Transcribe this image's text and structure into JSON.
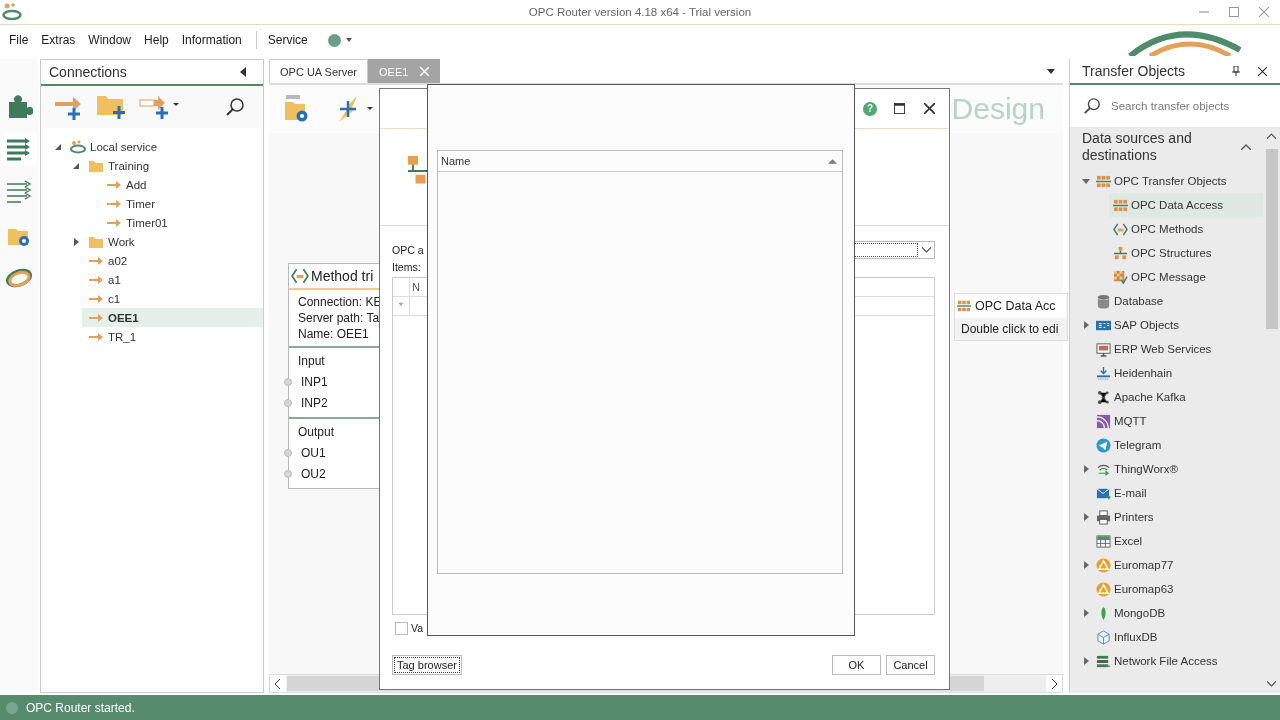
{
  "window": {
    "title": "OPC Router version 4.18 x64 - Trial version"
  },
  "menu": [
    "File",
    "Extras",
    "Window",
    "Help",
    "Information"
  ],
  "service_menu": "Service",
  "connections": {
    "title": "Connections",
    "tree": [
      {
        "label": "Local service",
        "kind": "service",
        "expanded": true,
        "selected": false,
        "children": [
          {
            "label": "Training",
            "kind": "folder",
            "expanded": true,
            "selected": false,
            "children": [
              {
                "label": "Add",
                "kind": "connection",
                "selected": false
              },
              {
                "label": "Timer",
                "kind": "connection",
                "selected": false
              },
              {
                "label": "Timer01",
                "kind": "connection",
                "selected": false
              }
            ]
          },
          {
            "label": "Work",
            "kind": "folder",
            "expanded": false,
            "selected": false
          },
          {
            "label": "a02",
            "kind": "connection",
            "selected": false
          },
          {
            "label": "a1",
            "kind": "connection",
            "selected": false
          },
          {
            "label": "c1",
            "kind": "connection",
            "selected": false
          },
          {
            "label": "OEE1",
            "kind": "connection",
            "selected": true
          },
          {
            "label": "TR_1",
            "kind": "connection",
            "selected": false
          }
        ]
      }
    ]
  },
  "document": {
    "tabs": [
      {
        "label": "OPC UA Server",
        "selected": false
      },
      {
        "label": "OEE1",
        "selected": true
      }
    ],
    "canvas_title": "Design",
    "method_node": {
      "title": "Method tri",
      "details": [
        "Connection: KE",
        "Server path: Ta",
        "Name: OEE1"
      ],
      "sections": [
        {
          "title": "Input",
          "ports": [
            "INP1",
            "INP2"
          ]
        },
        {
          "title": "Output",
          "ports": [
            "OU1",
            "OU2"
          ]
        }
      ]
    },
    "data_access_node": {
      "title": "OPC Data Acc",
      "hint": "Double click to edi"
    }
  },
  "dialog": {
    "help": "?",
    "label": "OPC a",
    "items_label": "Items:",
    "grid_column": "N",
    "new_row_marker": "*",
    "checkbox": {
      "label": "Va",
      "checked": false
    },
    "tag_browser": "Tag browser",
    "ok": "OK",
    "cancel": "Cancel"
  },
  "browser_dialog": {
    "column": "Name"
  },
  "transfer_objects": {
    "title": "Transfer Objects",
    "search_placeholder": "Search transfer objects",
    "section": {
      "title": "Data sources and destinations",
      "expanded": true
    },
    "items": [
      {
        "label": "OPC Transfer Objects",
        "kind": "opc-group",
        "expanded": true,
        "selected": false,
        "children": [
          {
            "label": "OPC Data Access",
            "kind": "opc-data",
            "selected": true
          },
          {
            "label": "OPC Methods",
            "kind": "opc-method",
            "selected": false
          },
          {
            "label": "OPC Structures",
            "kind": "opc-structure",
            "selected": false
          },
          {
            "label": "OPC Message",
            "kind": "opc-message",
            "selected": false
          }
        ]
      },
      {
        "label": "Database",
        "kind": "database",
        "selected": false
      },
      {
        "label": "SAP Objects",
        "kind": "sap",
        "expanded": false,
        "selected": false
      },
      {
        "label": "ERP Web Services",
        "kind": "erp",
        "selected": false
      },
      {
        "label": "Heidenhain",
        "kind": "heidenhain",
        "selected": false
      },
      {
        "label": "Apache Kafka",
        "kind": "kafka",
        "selected": false
      },
      {
        "label": "MQTT",
        "kind": "mqtt",
        "selected": false
      },
      {
        "label": "Telegram",
        "kind": "telegram",
        "selected": false
      },
      {
        "label": "ThingWorx®",
        "kind": "thingworx",
        "expanded": false,
        "selected": false
      },
      {
        "label": "E-mail",
        "kind": "email",
        "selected": false
      },
      {
        "label": "Printers",
        "kind": "printer",
        "expanded": false,
        "selected": false
      },
      {
        "label": "Excel",
        "kind": "excel",
        "selected": false
      },
      {
        "label": "Euromap77",
        "kind": "euromap",
        "expanded": false,
        "selected": false
      },
      {
        "label": "Euromap63",
        "kind": "euromap",
        "selected": false
      },
      {
        "label": "MongoDB",
        "kind": "mongodb",
        "expanded": false,
        "selected": false
      },
      {
        "label": "InfluxDB",
        "kind": "influxdb",
        "selected": false
      },
      {
        "label": "Network File Access",
        "kind": "network",
        "expanded": false,
        "selected": false
      }
    ]
  },
  "status_bar": {
    "text": "OPC Router started."
  }
}
